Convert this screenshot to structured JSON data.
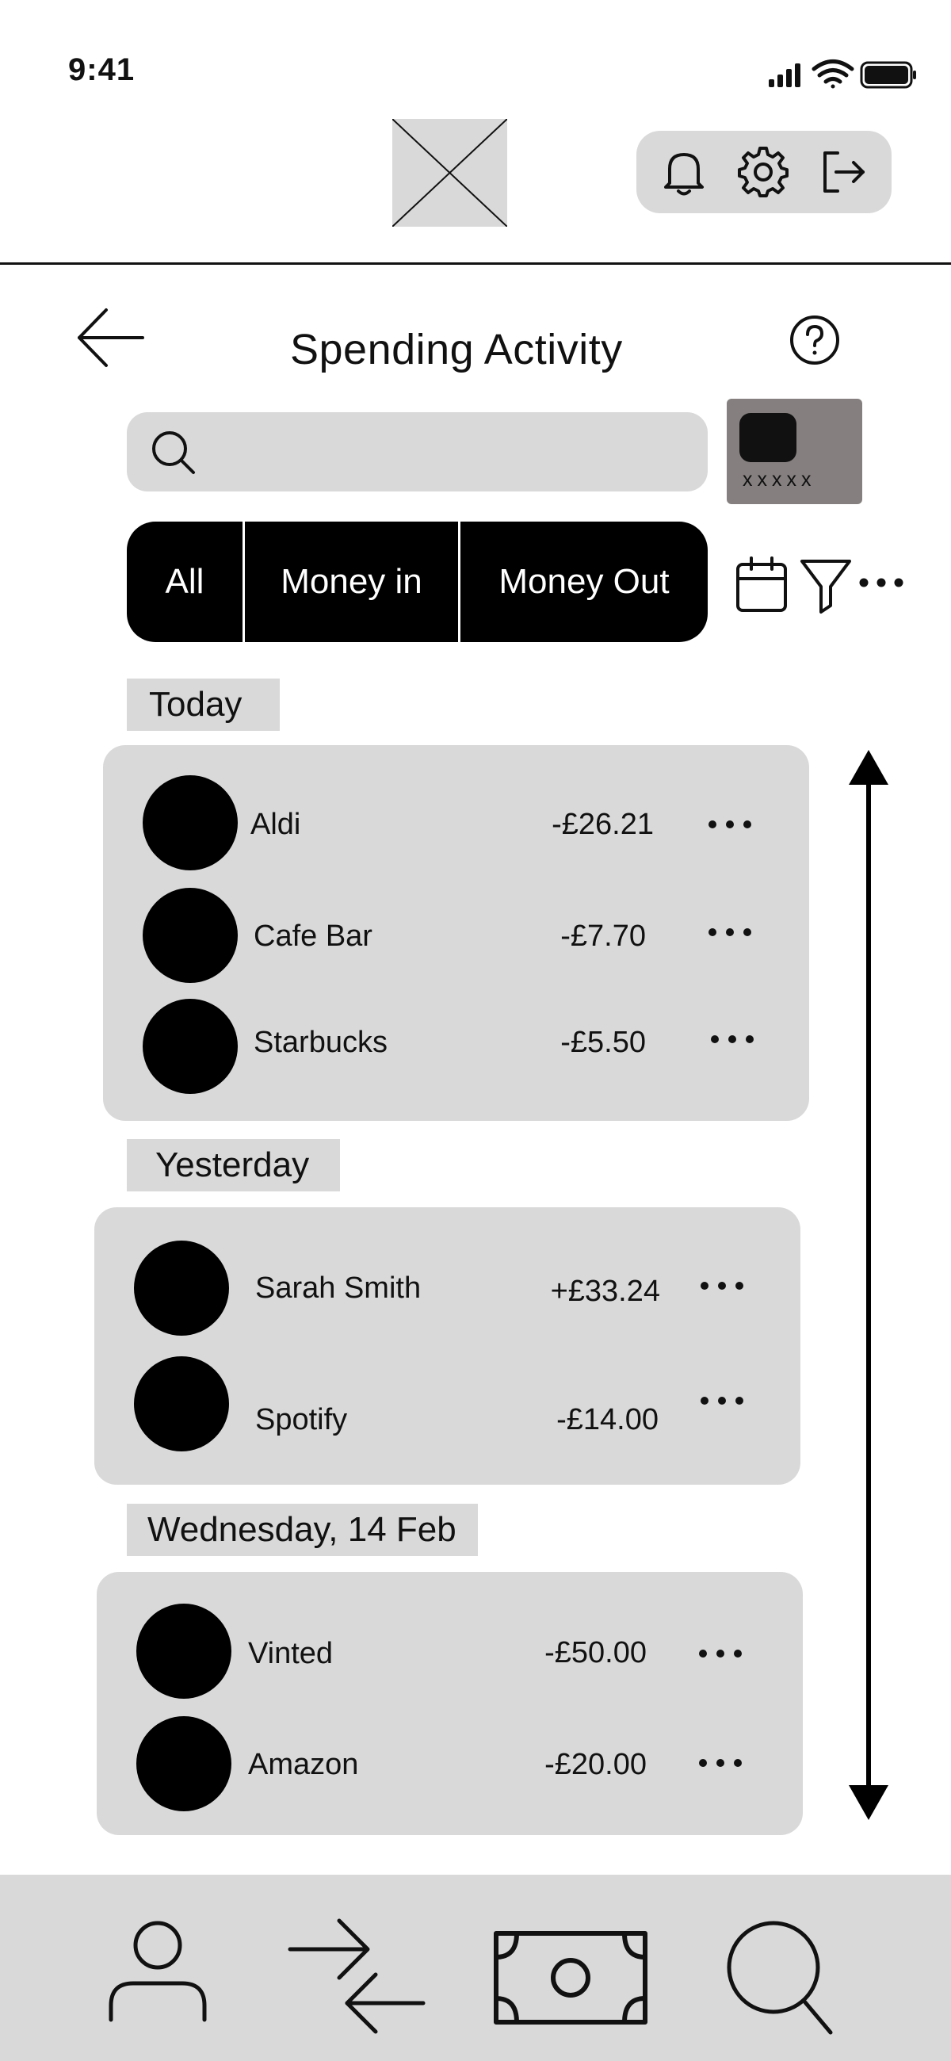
{
  "status_bar": {
    "time": "9:41",
    "icons": [
      "cellular-signal-icon",
      "wifi-icon",
      "battery-icon"
    ]
  },
  "header": {
    "logo": "logo-placeholder",
    "actions": [
      {
        "name": "notifications",
        "icon": "bell-icon"
      },
      {
        "name": "settings",
        "icon": "gear-icon"
      },
      {
        "name": "logout",
        "icon": "logout-icon"
      }
    ]
  },
  "page": {
    "title": "Spending Activity",
    "back_icon": "arrow-left-icon",
    "help_icon": "question-circle-icon"
  },
  "search": {
    "placeholder": "",
    "value": ""
  },
  "card": {
    "number_mask": "xxxxx"
  },
  "filters": {
    "tabs": [
      "All",
      "Money in",
      "Money Out"
    ],
    "selected": "All",
    "tools": [
      "calendar-icon",
      "filter-icon",
      "more-icon"
    ]
  },
  "transactions": {
    "groups": [
      {
        "label": "Today",
        "items": [
          {
            "name": "Aldi",
            "amount": "-£26.21"
          },
          {
            "name": "Cafe Bar",
            "amount": "-£7.70"
          },
          {
            "name": "Starbucks",
            "amount": "-£5.50"
          }
        ]
      },
      {
        "label": "Yesterday",
        "items": [
          {
            "name": "Sarah Smith",
            "amount": "+£33.24"
          },
          {
            "name": "Spotify",
            "amount": "-£14.00"
          }
        ]
      },
      {
        "label": "Wednesday, 14 Feb",
        "items": [
          {
            "name": "Vinted",
            "amount": "-£50.00"
          },
          {
            "name": "Amazon",
            "amount": "-£20.00"
          }
        ]
      }
    ]
  },
  "bottom_nav": {
    "items": [
      {
        "name": "profile",
        "icon": "person-icon"
      },
      {
        "name": "transfers",
        "icon": "transfer-arrows-icon"
      },
      {
        "name": "payments",
        "icon": "banknote-icon"
      },
      {
        "name": "search",
        "icon": "search-icon"
      }
    ]
  },
  "colors": {
    "background": "#ffffff",
    "panel": "#d9d9d9",
    "card": "#857f7f",
    "ink": "#000000"
  }
}
